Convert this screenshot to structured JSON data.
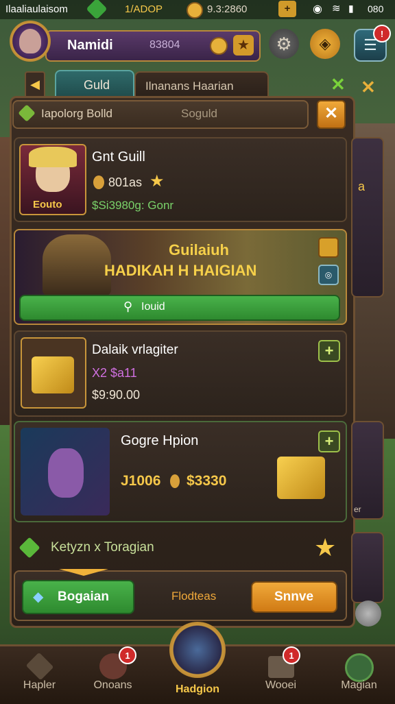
{
  "status_bar": {
    "left_text": "Ilaaliaulaisom",
    "center_value": "1/ADOP",
    "coins_value": "9.3:2860",
    "time": "080"
  },
  "player": {
    "name": "Namidi",
    "currency_value": "83804"
  },
  "tabs": [
    {
      "label": "Guld",
      "active": true
    },
    {
      "label": "Ilnanans Haarian",
      "active": false
    }
  ],
  "search": {
    "label": "Iapolorg Bolld",
    "placeholder": "Soguld"
  },
  "guild_card": {
    "title": "Gnt Guill",
    "level_value": "801as",
    "stat_text": "$Si3980g: Gonr",
    "portrait_label": "Eouto"
  },
  "banner": {
    "line1": "Guilaiuh",
    "line2": "HADIKAH H HAIGIAN",
    "button_label": "Iouid"
  },
  "offer1": {
    "title": "Dalaik vrlagiter",
    "sub": "X2  $a11",
    "price": "$9:90.00"
  },
  "offer2": {
    "title": "Gogre Hpion",
    "value_left": "J1006",
    "value_right": "$3330"
  },
  "reward_row": {
    "label": "Ketyzn x Toragian"
  },
  "action_row": {
    "left_button": "Bogaian",
    "middle_text": "Flodteas",
    "right_button": "Snnve"
  },
  "side_cards": {
    "label1": "a",
    "label2": "er"
  },
  "bottom_nav": [
    {
      "label": "Hapler",
      "badge": ""
    },
    {
      "label": "Onoans",
      "badge": "1"
    },
    {
      "label": "Hadgion",
      "badge": "",
      "active": true
    },
    {
      "label": "Wooei",
      "badge": "1"
    },
    {
      "label": "Magian",
      "badge": ""
    }
  ],
  "icons": {
    "gem": "gem-icon",
    "coin": "coin-icon",
    "settings": "gear-icon",
    "shield": "shield-icon",
    "mail": "mail-icon",
    "close": "close-icon",
    "search": "search-icon"
  },
  "colors": {
    "gold": "#f6c84a",
    "green": "#3fa43f",
    "orange": "#e08a20",
    "panel": "#2e231b"
  }
}
